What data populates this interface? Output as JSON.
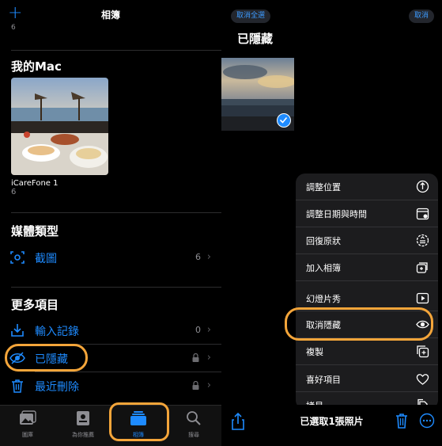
{
  "left": {
    "header": {
      "title": "相簿",
      "plus": "+"
    },
    "top_count": "6",
    "my_mac": {
      "title": "我的Mac",
      "album": {
        "name": "iCareFone 1",
        "count": "6"
      }
    },
    "media_types": {
      "title": "媒體類型",
      "items": [
        {
          "label": "截圖",
          "count": "6"
        }
      ]
    },
    "more_items": {
      "title": "更多項目",
      "items": [
        {
          "label": "輸入記錄",
          "count": "0"
        },
        {
          "label": "已隱藏"
        },
        {
          "label": "最近刪除"
        }
      ]
    },
    "tabbar": {
      "tabs": [
        {
          "label": "圖庫",
          "icon": "photos-library-icon"
        },
        {
          "label": "為你推薦",
          "icon": "for-you-icon"
        },
        {
          "label": "相簿",
          "icon": "albums-icon",
          "active": true
        },
        {
          "label": "搜尋",
          "icon": "search-icon"
        }
      ]
    }
  },
  "right": {
    "deselect_all": "取消全選",
    "cancel": "取消",
    "title": "已隱藏",
    "menu": [
      {
        "label": "調整位置",
        "icon": "adjust-location-icon"
      },
      {
        "label": "調整日期與時間",
        "icon": "calendar-icon"
      },
      {
        "label": "回復原狀",
        "icon": "revert-icon"
      },
      {
        "label": "加入相簿",
        "icon": "add-to-album-icon"
      },
      {
        "label": "幻燈片秀",
        "icon": "slideshow-icon"
      },
      {
        "label": "取消隱藏",
        "icon": "eye-icon"
      },
      {
        "label": "複製",
        "icon": "duplicate-icon"
      },
      {
        "label": "喜好項目",
        "icon": "heart-icon"
      },
      {
        "label": "拷貝",
        "icon": "copy-icon"
      }
    ],
    "selected_count": "已選取1張照片"
  },
  "colors": {
    "accent": "#1e8bff",
    "highlight": "#f4a53a",
    "muted": "#8e8e93"
  }
}
